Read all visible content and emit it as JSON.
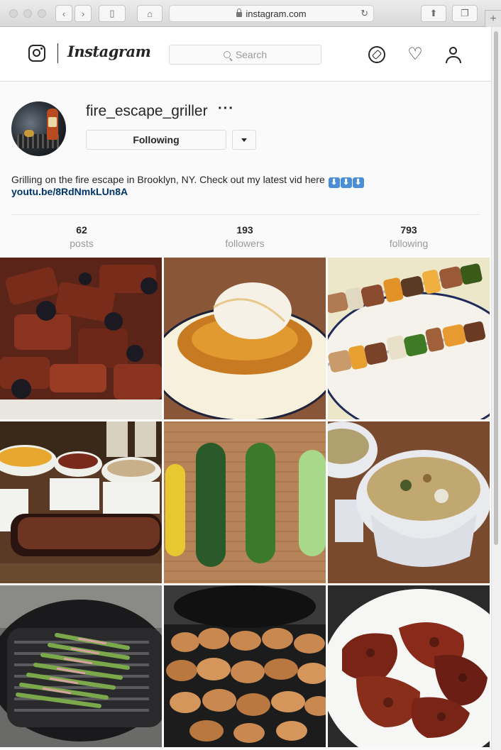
{
  "browser": {
    "url": "instagram.com",
    "back_icon": "chevron-left-icon",
    "forward_icon": "chevron-right-icon",
    "sidebar_icon": "sidebar-icon",
    "home_icon": "home-icon",
    "share_icon": "share-icon",
    "tabs_icon": "tabs-icon",
    "new_tab_icon": "plus-icon",
    "reload_icon": "reload-icon"
  },
  "nav": {
    "brand": "Instagram",
    "search_placeholder": "Search",
    "icons": [
      "compass-icon",
      "heart-icon",
      "user-icon"
    ]
  },
  "profile": {
    "username": "fire_escape_griller",
    "more_label": "···",
    "follow_button": "Following",
    "bio_text": "Grilling on the fire escape in Brooklyn, NY. Check out my latest vid here",
    "bio_emoji": [
      "⬇",
      "⬇",
      "⬇"
    ],
    "link": "youtu.be/8RdNmkLUn8A"
  },
  "stats": [
    {
      "value": "62",
      "label": "posts"
    },
    {
      "value": "193",
      "label": "followers"
    },
    {
      "value": "793",
      "label": "following"
    }
  ],
  "posts": [
    {
      "subject": "bbq ribs with blackberries"
    },
    {
      "subject": "grilled pineapple with ice cream"
    },
    {
      "subject": "chicken and pepper skewers"
    },
    {
      "subject": "brisket with mac and cheese sides"
    },
    {
      "subject": "zucchini and squash"
    },
    {
      "subject": "creamy soup in bowl"
    },
    {
      "subject": "bacon wrapped asparagus on grill"
    },
    {
      "subject": "grilled chicken wings"
    },
    {
      "subject": "bbq glazed chicken"
    }
  ]
}
